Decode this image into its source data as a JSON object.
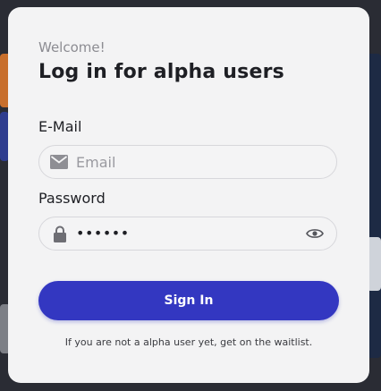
{
  "login": {
    "welcome": "Welcome!",
    "title": "Log in for alpha users",
    "email_label": "E-Mail",
    "email_placeholder": "Email",
    "password_label": "Password",
    "password_value": "••••••",
    "signin_label": "Sign In",
    "footer_note": "If you are not a alpha user yet, get on the waitlist."
  },
  "icons": {
    "email": "mail-icon",
    "password": "lock-icon",
    "toggle_visibility": "eye-icon"
  },
  "colors": {
    "primary_button": "#3337c1",
    "modal_bg": "#f3f3f4",
    "backdrop": "#2a2c34"
  }
}
